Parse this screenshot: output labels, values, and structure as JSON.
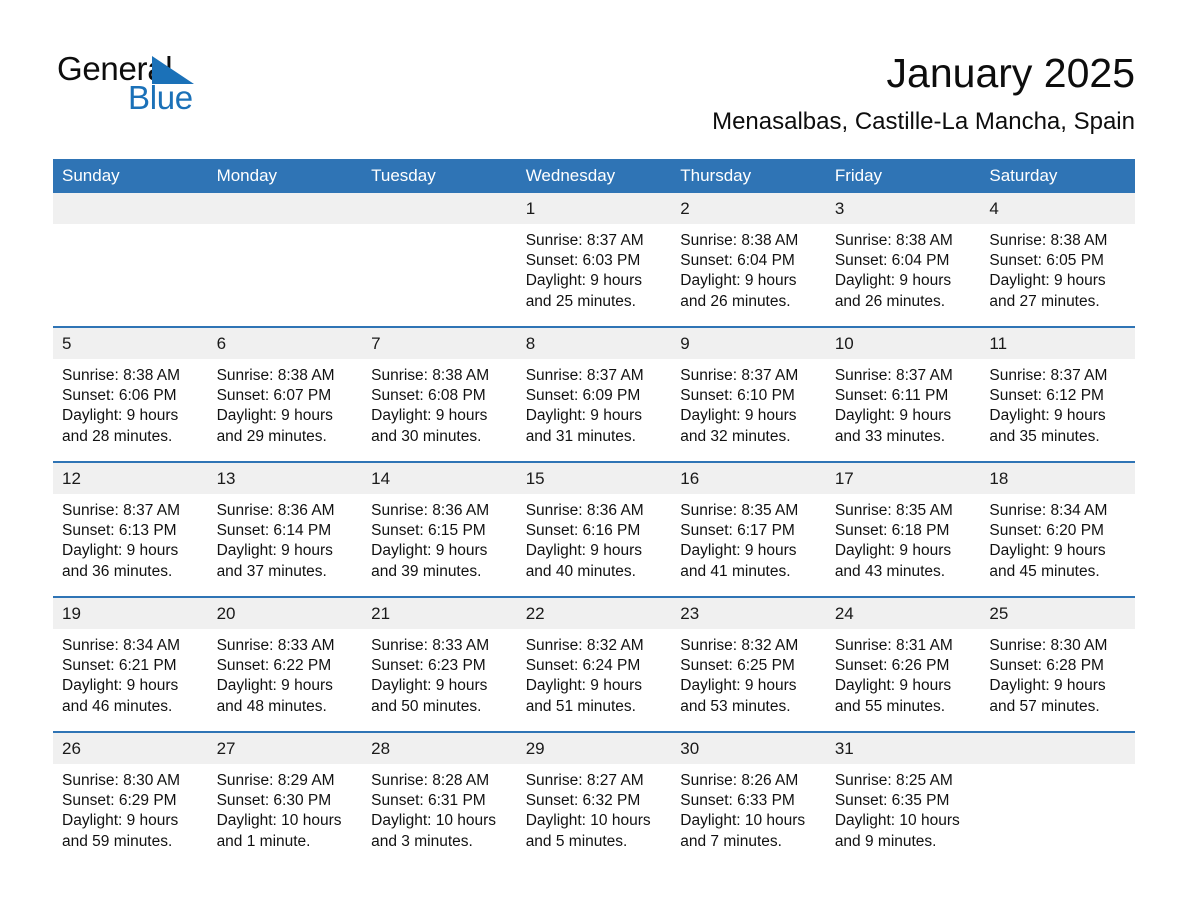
{
  "brand": {
    "logo_text_primary": "General",
    "logo_text_secondary": "Blue",
    "logo_icon": "triangle-icon",
    "accent_color": "#2f74b5",
    "header_bg_color": "#2f74b5",
    "daynum_bg_color": "#f0f0f0"
  },
  "header": {
    "title": "January 2025",
    "subtitle": "Menasalbas, Castille-La Mancha, Spain"
  },
  "weekday_headers": [
    "Sunday",
    "Monday",
    "Tuesday",
    "Wednesday",
    "Thursday",
    "Friday",
    "Saturday"
  ],
  "labels": {
    "sunrise_prefix": "Sunrise:",
    "sunset_prefix": "Sunset:",
    "daylight_prefix": "Daylight:"
  },
  "weeks": [
    [
      {
        "day": "",
        "blank": true,
        "sunrise": "",
        "sunset": "",
        "daylight": ""
      },
      {
        "day": "",
        "blank": true,
        "sunrise": "",
        "sunset": "",
        "daylight": ""
      },
      {
        "day": "",
        "blank": true,
        "sunrise": "",
        "sunset": "",
        "daylight": ""
      },
      {
        "day": "1",
        "sunrise": "Sunrise: 8:37 AM",
        "sunset": "Sunset: 6:03 PM",
        "daylight": "Daylight: 9 hours and 25 minutes."
      },
      {
        "day": "2",
        "sunrise": "Sunrise: 8:38 AM",
        "sunset": "Sunset: 6:04 PM",
        "daylight": "Daylight: 9 hours and 26 minutes."
      },
      {
        "day": "3",
        "sunrise": "Sunrise: 8:38 AM",
        "sunset": "Sunset: 6:04 PM",
        "daylight": "Daylight: 9 hours and 26 minutes."
      },
      {
        "day": "4",
        "sunrise": "Sunrise: 8:38 AM",
        "sunset": "Sunset: 6:05 PM",
        "daylight": "Daylight: 9 hours and 27 minutes."
      }
    ],
    [
      {
        "day": "5",
        "sunrise": "Sunrise: 8:38 AM",
        "sunset": "Sunset: 6:06 PM",
        "daylight": "Daylight: 9 hours and 28 minutes."
      },
      {
        "day": "6",
        "sunrise": "Sunrise: 8:38 AM",
        "sunset": "Sunset: 6:07 PM",
        "daylight": "Daylight: 9 hours and 29 minutes."
      },
      {
        "day": "7",
        "sunrise": "Sunrise: 8:38 AM",
        "sunset": "Sunset: 6:08 PM",
        "daylight": "Daylight: 9 hours and 30 minutes."
      },
      {
        "day": "8",
        "sunrise": "Sunrise: 8:37 AM",
        "sunset": "Sunset: 6:09 PM",
        "daylight": "Daylight: 9 hours and 31 minutes."
      },
      {
        "day": "9",
        "sunrise": "Sunrise: 8:37 AM",
        "sunset": "Sunset: 6:10 PM",
        "daylight": "Daylight: 9 hours and 32 minutes."
      },
      {
        "day": "10",
        "sunrise": "Sunrise: 8:37 AM",
        "sunset": "Sunset: 6:11 PM",
        "daylight": "Daylight: 9 hours and 33 minutes."
      },
      {
        "day": "11",
        "sunrise": "Sunrise: 8:37 AM",
        "sunset": "Sunset: 6:12 PM",
        "daylight": "Daylight: 9 hours and 35 minutes."
      }
    ],
    [
      {
        "day": "12",
        "sunrise": "Sunrise: 8:37 AM",
        "sunset": "Sunset: 6:13 PM",
        "daylight": "Daylight: 9 hours and 36 minutes."
      },
      {
        "day": "13",
        "sunrise": "Sunrise: 8:36 AM",
        "sunset": "Sunset: 6:14 PM",
        "daylight": "Daylight: 9 hours and 37 minutes."
      },
      {
        "day": "14",
        "sunrise": "Sunrise: 8:36 AM",
        "sunset": "Sunset: 6:15 PM",
        "daylight": "Daylight: 9 hours and 39 minutes."
      },
      {
        "day": "15",
        "sunrise": "Sunrise: 8:36 AM",
        "sunset": "Sunset: 6:16 PM",
        "daylight": "Daylight: 9 hours and 40 minutes."
      },
      {
        "day": "16",
        "sunrise": "Sunrise: 8:35 AM",
        "sunset": "Sunset: 6:17 PM",
        "daylight": "Daylight: 9 hours and 41 minutes."
      },
      {
        "day": "17",
        "sunrise": "Sunrise: 8:35 AM",
        "sunset": "Sunset: 6:18 PM",
        "daylight": "Daylight: 9 hours and 43 minutes."
      },
      {
        "day": "18",
        "sunrise": "Sunrise: 8:34 AM",
        "sunset": "Sunset: 6:20 PM",
        "daylight": "Daylight: 9 hours and 45 minutes."
      }
    ],
    [
      {
        "day": "19",
        "sunrise": "Sunrise: 8:34 AM",
        "sunset": "Sunset: 6:21 PM",
        "daylight": "Daylight: 9 hours and 46 minutes."
      },
      {
        "day": "20",
        "sunrise": "Sunrise: 8:33 AM",
        "sunset": "Sunset: 6:22 PM",
        "daylight": "Daylight: 9 hours and 48 minutes."
      },
      {
        "day": "21",
        "sunrise": "Sunrise: 8:33 AM",
        "sunset": "Sunset: 6:23 PM",
        "daylight": "Daylight: 9 hours and 50 minutes."
      },
      {
        "day": "22",
        "sunrise": "Sunrise: 8:32 AM",
        "sunset": "Sunset: 6:24 PM",
        "daylight": "Daylight: 9 hours and 51 minutes."
      },
      {
        "day": "23",
        "sunrise": "Sunrise: 8:32 AM",
        "sunset": "Sunset: 6:25 PM",
        "daylight": "Daylight: 9 hours and 53 minutes."
      },
      {
        "day": "24",
        "sunrise": "Sunrise: 8:31 AM",
        "sunset": "Sunset: 6:26 PM",
        "daylight": "Daylight: 9 hours and 55 minutes."
      },
      {
        "day": "25",
        "sunrise": "Sunrise: 8:30 AM",
        "sunset": "Sunset: 6:28 PM",
        "daylight": "Daylight: 9 hours and 57 minutes."
      }
    ],
    [
      {
        "day": "26",
        "sunrise": "Sunrise: 8:30 AM",
        "sunset": "Sunset: 6:29 PM",
        "daylight": "Daylight: 9 hours and 59 minutes."
      },
      {
        "day": "27",
        "sunrise": "Sunrise: 8:29 AM",
        "sunset": "Sunset: 6:30 PM",
        "daylight": "Daylight: 10 hours and 1 minute."
      },
      {
        "day": "28",
        "sunrise": "Sunrise: 8:28 AM",
        "sunset": "Sunset: 6:31 PM",
        "daylight": "Daylight: 10 hours and 3 minutes."
      },
      {
        "day": "29",
        "sunrise": "Sunrise: 8:27 AM",
        "sunset": "Sunset: 6:32 PM",
        "daylight": "Daylight: 10 hours and 5 minutes."
      },
      {
        "day": "30",
        "sunrise": "Sunrise: 8:26 AM",
        "sunset": "Sunset: 6:33 PM",
        "daylight": "Daylight: 10 hours and 7 minutes."
      },
      {
        "day": "31",
        "sunrise": "Sunrise: 8:25 AM",
        "sunset": "Sunset: 6:35 PM",
        "daylight": "Daylight: 10 hours and 9 minutes."
      },
      {
        "day": "",
        "blank": true,
        "sunrise": "",
        "sunset": "",
        "daylight": ""
      }
    ]
  ]
}
